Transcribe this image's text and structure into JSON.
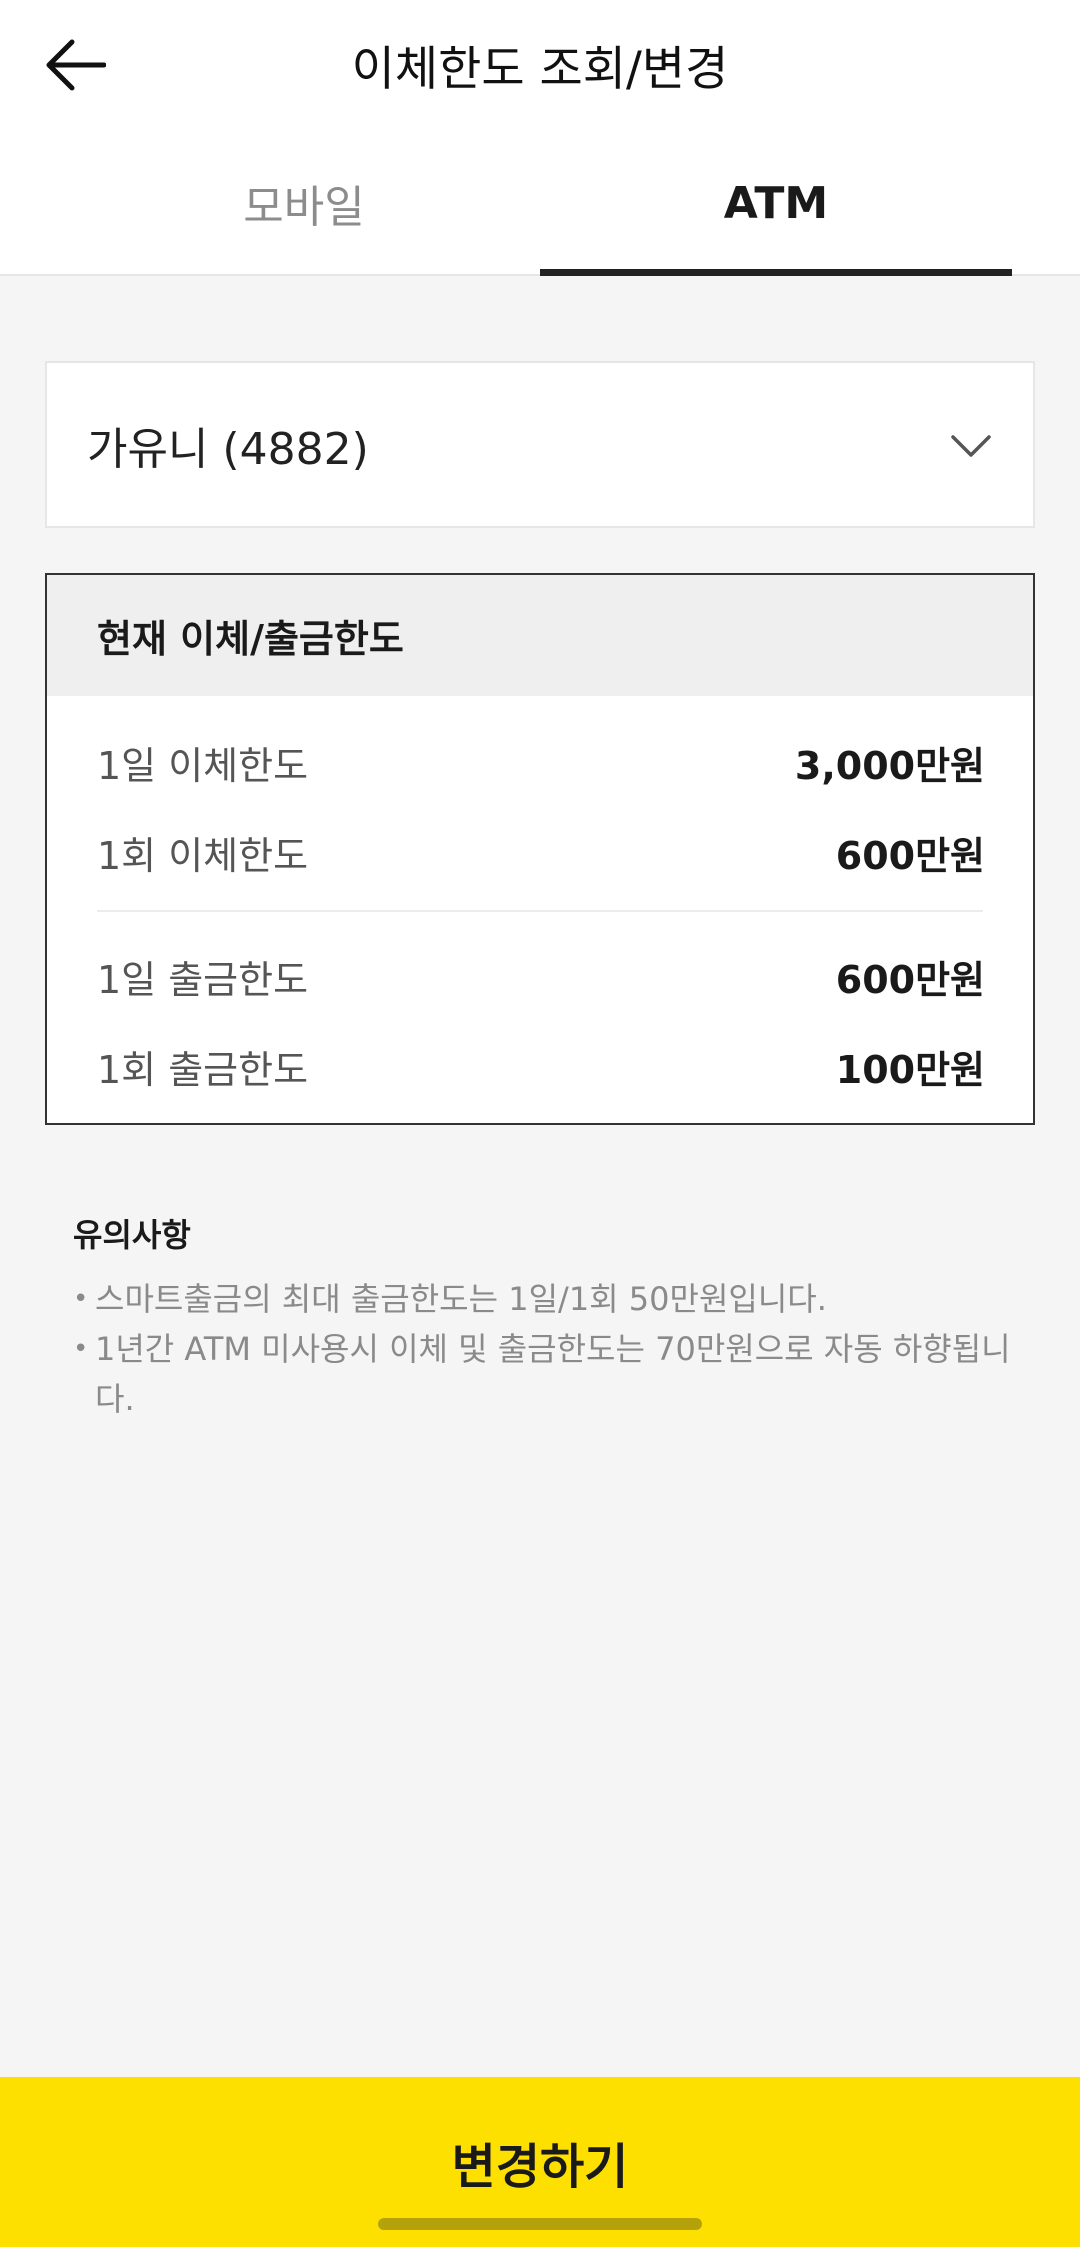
{
  "header": {
    "title": "이체한도 조회/변경",
    "back_icon": "arrow-left-icon"
  },
  "tabs": [
    {
      "label": "모바일",
      "selected": false
    },
    {
      "label": "ATM",
      "selected": true
    }
  ],
  "account": {
    "label": "가유니 (4882)",
    "dropdown_icon": "chevron-down-icon"
  },
  "limits": {
    "heading": "현재 이체/출금한도",
    "rows": [
      {
        "label": "1일 이체한도",
        "value": "3,000만원"
      },
      {
        "label": "1회 이체한도",
        "value": "600만원"
      },
      {
        "label": "1일 출금한도",
        "value": "600만원"
      },
      {
        "label": "1회 출금한도",
        "value": "100만원"
      }
    ]
  },
  "notice": {
    "title": "유의사항",
    "bullet": "•",
    "items": [
      "스마트출금의 최대 출금한도는 1일/1회 50만원입니다.",
      "1년간 ATM 미사용시 이체 및 출금한도는 70만원으로 자동 하향됩니다."
    ]
  },
  "cta": {
    "label": "변경하기"
  },
  "colors": {
    "accent": "#fde000",
    "background": "#f5f5f5",
    "tab_indicator": "#222222"
  }
}
